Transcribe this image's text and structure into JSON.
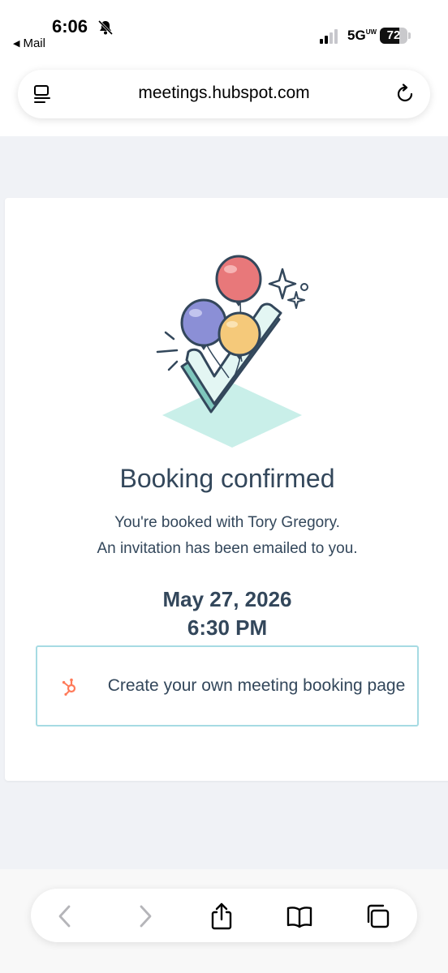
{
  "status_bar": {
    "time": "6:06",
    "back_app": "Mail",
    "network": "5G",
    "network_suffix": "UW",
    "battery": "72",
    "battery_level": 0.72
  },
  "browser": {
    "url": "meetings.hubspot.com"
  },
  "confirmation": {
    "heading": "Booking confirmed",
    "line1": "You're booked with Tory Gregory.",
    "line2": "An invitation has been emailed to you.",
    "date": "May 27, 2026",
    "time": "6:30 PM",
    "cta_label": "Create your own meeting booking page"
  },
  "colors": {
    "text": "#33475b",
    "cta_border": "#a6dbe3",
    "hubspot_orange": "#ff7a59",
    "balloon_red": "#e8787a",
    "balloon_purple": "#8b8fd6",
    "balloon_yellow": "#f5c97a",
    "check_teal": "#c9efe9"
  },
  "icons": {
    "bell": "bell-slash-icon",
    "reader": "reader-mode-icon",
    "reload": "reload-icon",
    "back": "chevron-left-icon",
    "forward": "chevron-right-icon",
    "share": "share-icon",
    "bookmarks": "book-icon",
    "tabs": "tabs-icon",
    "brand": "hubspot-sprocket-icon"
  }
}
